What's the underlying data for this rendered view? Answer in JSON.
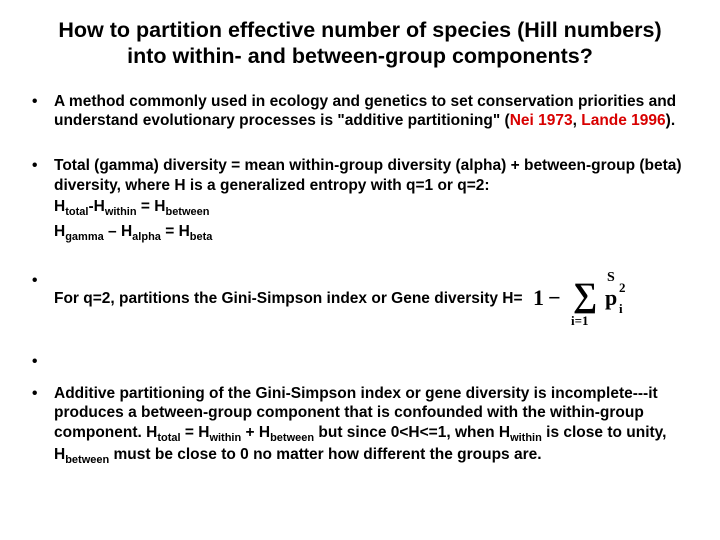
{
  "title": "How to partition effective number of species (Hill numbers) into within- and between-group components?",
  "bullets": {
    "b1": {
      "text_a": "A method commonly used in ecology and genetics to set conservation priorities and understand evolutionary processes is \"additive partitioning\" (",
      "ref1": "Nei 1973",
      "sep": ", ",
      "ref2": "Lande 1996",
      "text_b": ")."
    },
    "b2": {
      "text": "Total (gamma) diversity = mean within-group diversity (alpha) + between-group (beta) diversity, where H is a generalized entropy with q=1 or q=2:",
      "eq1": {
        "Ht": "H",
        "t": "total",
        "m": "-",
        "Hw": "H",
        "w": "within",
        "eq": " = ",
        "Hb": "H",
        "b": "between"
      },
      "eq2": {
        "Hg": "H",
        "g": "gamma",
        "m": " – ",
        "Ha": "H",
        "a": "alpha",
        "eq": " = ",
        "Hb": "H",
        "b": "beta"
      }
    },
    "b3": {
      "text": "For q=2, partitions the Gini-Simpson index or Gene diversity H="
    },
    "b5": {
      "strong": "Additive partitioning of the Gini-Simpson index or gene diversity is incomplete---it produces a between-group component that is confounded with the within-group component.",
      "tail_a": " H",
      "t": "total",
      "tail_b": " = H",
      "w": "within",
      "tail_c": " + H",
      "b": "between",
      "tail_d": " but since 0<H<=1, when H",
      "w2": "within",
      "tail_e": " is close to unity, H",
      "b2": "between",
      "tail_f": " must be close to 0 no matter how different the groups are."
    }
  }
}
